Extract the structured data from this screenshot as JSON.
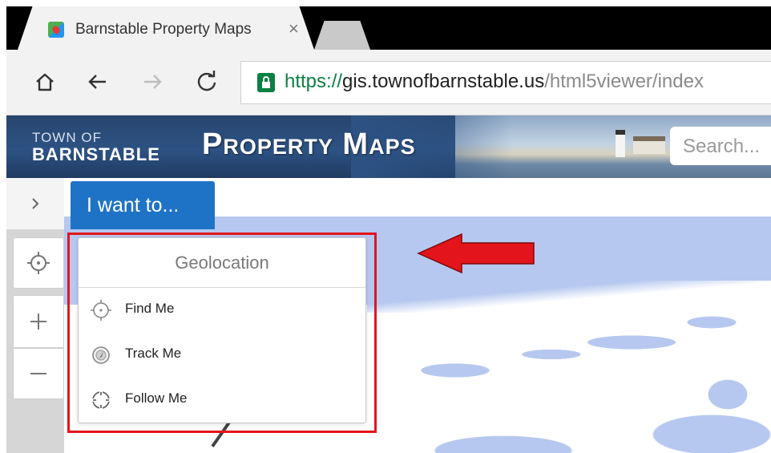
{
  "browser": {
    "tab_title": "Barnstable Property Maps",
    "tab_close": "×",
    "url_scheme": "https://",
    "url_host": "gis.townofbarnstable.us",
    "url_path": "/html5viewer/index",
    "icons": [
      "home-icon",
      "back-icon",
      "forward-icon",
      "reload-icon",
      "lock-icon"
    ]
  },
  "header": {
    "brand_line1": "TOWN OF",
    "brand_line2": "BARNSTABLE",
    "title": "Property Maps",
    "search_placeholder": "Search..."
  },
  "toolbar": {
    "expand_icon": "chevron-right-icon",
    "i_want_to": "I want to...",
    "accent_color": "#1f73c7"
  },
  "map_tools": [
    {
      "name": "geolocate",
      "icon": "crosshair-icon"
    },
    {
      "name": "zoom-in",
      "icon": "plus-icon"
    },
    {
      "name": "zoom-out",
      "icon": "minus-icon"
    }
  ],
  "geolocation": {
    "title": "Geolocation",
    "items": [
      {
        "label": "Find Me",
        "icon": "crosshair-icon"
      },
      {
        "label": "Track Me",
        "icon": "compass-icon"
      },
      {
        "label": "Follow Me",
        "icon": "follow-target-icon"
      }
    ]
  },
  "annotation": {
    "highlight_color": "#e3141b"
  }
}
